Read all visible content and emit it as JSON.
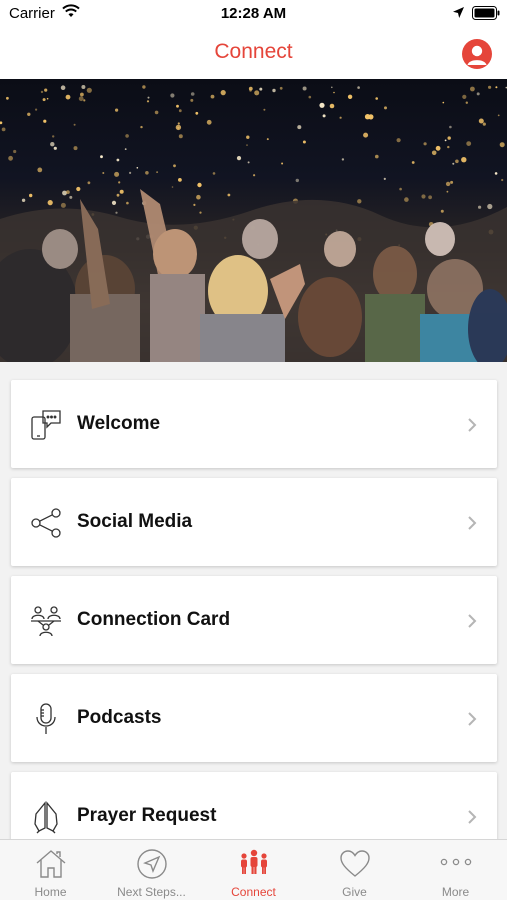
{
  "status_bar": {
    "carrier": "Carrier",
    "time": "12:28 AM"
  },
  "nav": {
    "title": "Connect"
  },
  "colors": {
    "accent": "#e5453a",
    "tab_inactive": "#8a8a8a"
  },
  "menu_items": [
    {
      "label": "Welcome",
      "icon": "phone-chat-icon"
    },
    {
      "label": "Social Media",
      "icon": "share-icon"
    },
    {
      "label": "Connection Card",
      "icon": "people-connection-icon"
    },
    {
      "label": "Podcasts",
      "icon": "microphone-icon"
    },
    {
      "label": "Prayer Request",
      "icon": "praying-hands-icon"
    }
  ],
  "tabs": [
    {
      "label": "Home",
      "icon": "home-icon",
      "active": false
    },
    {
      "label": "Next Steps...",
      "icon": "compass-icon",
      "active": false
    },
    {
      "label": "Connect",
      "icon": "people-icon",
      "active": true
    },
    {
      "label": "Give",
      "icon": "heart-icon",
      "active": false
    },
    {
      "label": "More",
      "icon": "more-dots-icon",
      "active": false
    }
  ]
}
